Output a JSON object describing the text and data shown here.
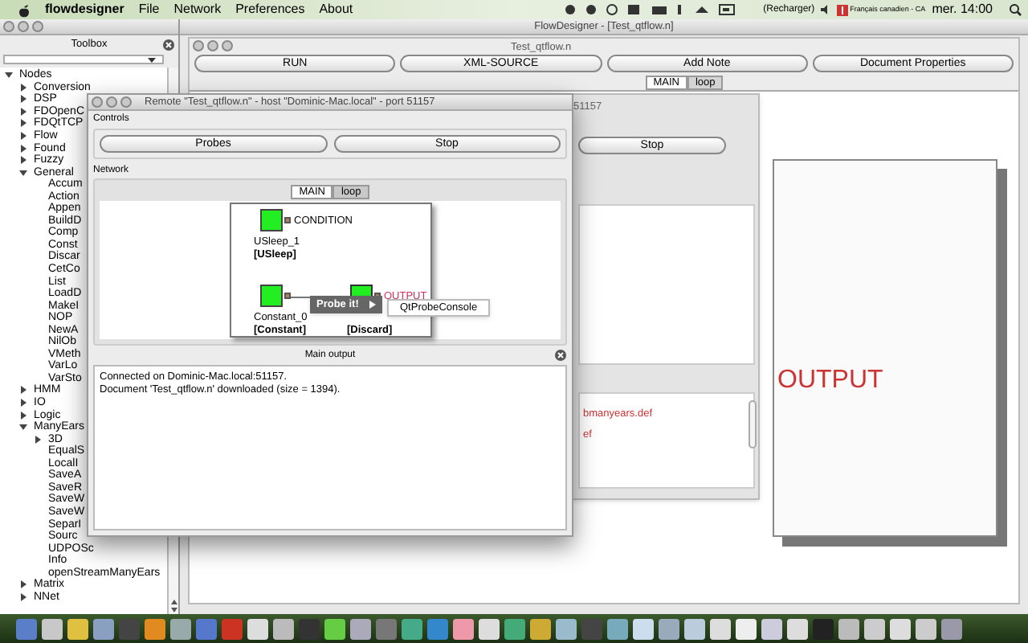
{
  "menu_bar": {
    "app": "flowdesigner",
    "menus": [
      "File",
      "Network",
      "Preferences",
      "About"
    ],
    "battery": "(Recharger)",
    "input_source": "Français canadien - CA",
    "clock": "mer. 14:00"
  },
  "toolbox": {
    "title": "Toolbox",
    "tree": [
      {
        "label": "Nodes",
        "expanded": true,
        "children": [
          {
            "label": "Conversion",
            "expanded": false
          },
          {
            "label": "DSP",
            "expanded": false
          },
          {
            "label": "FDOpenC",
            "expanded": false
          },
          {
            "label": "FDQtTCP",
            "expanded": false
          },
          {
            "label": "Flow",
            "expanded": false
          },
          {
            "label": "Found",
            "expanded": false
          },
          {
            "label": "Fuzzy",
            "expanded": false
          },
          {
            "label": "General",
            "expanded": true,
            "children": [
              {
                "label": "Accum"
              },
              {
                "label": "Action"
              },
              {
                "label": "Appen"
              },
              {
                "label": "BuildD"
              },
              {
                "label": "Comp"
              },
              {
                "label": "Const"
              },
              {
                "label": "Discar"
              },
              {
                "label": "CetCo"
              },
              {
                "label": "List"
              },
              {
                "label": "LoadD"
              },
              {
                "label": "MakeI"
              },
              {
                "label": "NOP"
              },
              {
                "label": "NewA"
              },
              {
                "label": "NilOb"
              },
              {
                "label": "VMeth"
              },
              {
                "label": "VarLo"
              },
              {
                "label": "VarSto"
              }
            ]
          },
          {
            "label": "HMM",
            "expanded": false
          },
          {
            "label": "IO",
            "expanded": false
          },
          {
            "label": "Logic",
            "expanded": false
          },
          {
            "label": "ManyEars",
            "expanded": true,
            "children": [
              {
                "label": "3D",
                "expanded": false
              },
              {
                "label": "EqualS"
              },
              {
                "label": "LocalI"
              },
              {
                "label": "SaveA"
              },
              {
                "label": "SaveR"
              },
              {
                "label": "SaveW"
              },
              {
                "label": "SaveW"
              },
              {
                "label": "SeparI"
              },
              {
                "label": "Sourc"
              },
              {
                "label": "UDPOSc"
              },
              {
                "label": "Info"
              },
              {
                "label": "openStreamManyEars"
              }
            ]
          },
          {
            "label": "Matrix",
            "expanded": false
          },
          {
            "label": "NNet",
            "expanded": false
          }
        ]
      }
    ]
  },
  "main_window": {
    "title": "FlowDesigner - [Test_qtflow.n]",
    "document_title": "Test_qtflow.n",
    "buttons": [
      "RUN",
      "XML-SOURCE",
      "Add Note",
      "Document Properties"
    ],
    "tabs": [
      {
        "label": "MAIN",
        "selected": true
      },
      {
        "label": "loop",
        "selected": false
      }
    ],
    "background_window": {
      "title": "51157",
      "stop_button": "Stop",
      "output_lines": [
        "bmanyears.def",
        "ef"
      ]
    },
    "note": {
      "text": "OUTPUT"
    }
  },
  "remote_window": {
    "title": "Remote \"Test_qtflow.n\" - host \"Dominic-Mac.local\" - port 51157",
    "controls_label": "Controls",
    "buttons": [
      "Probes",
      "Stop"
    ],
    "network_label": "Network",
    "tabs": [
      {
        "label": "MAIN",
        "selected": true
      },
      {
        "label": "loop",
        "selected": false
      }
    ],
    "nodes": [
      {
        "kind": "node",
        "name": "USleep_1",
        "type": "[USleep]",
        "output": "CONDITION"
      },
      {
        "kind": "node",
        "name": "Constant_0",
        "type": "[Constant]"
      },
      {
        "kind": "terminal",
        "type": "[Discard]",
        "output": "OUTPUT"
      }
    ],
    "context_menu": {
      "item": "Probe it!",
      "submenu_item": "QtProbeConsole"
    },
    "output_label": "Main output",
    "log": [
      "Connected on Dominic-Mac.local:51157.",
      "Document 'Test_qtflow.n' downloaded (size = 1394)."
    ]
  }
}
